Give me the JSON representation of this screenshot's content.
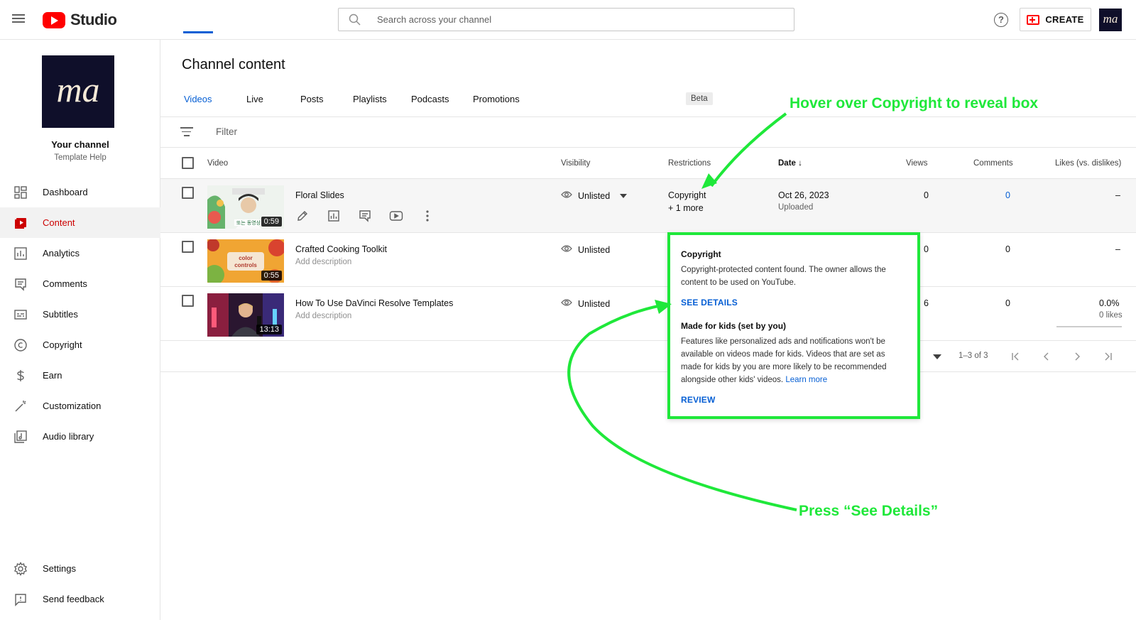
{
  "app": {
    "name": "Studio",
    "search_placeholder": "Search across your channel",
    "create_label": "CREATE",
    "avatar_initials": "ma"
  },
  "channel": {
    "initials": "ma",
    "name": "Your channel",
    "subtitle": "Template Help"
  },
  "sidebar": {
    "items": [
      {
        "label": "Dashboard",
        "icon": "dashboard-icon"
      },
      {
        "label": "Content",
        "icon": "content-icon",
        "active": true
      },
      {
        "label": "Analytics",
        "icon": "analytics-icon"
      },
      {
        "label": "Comments",
        "icon": "comments-icon"
      },
      {
        "label": "Subtitles",
        "icon": "subtitles-icon"
      },
      {
        "label": "Copyright",
        "icon": "copyright-icon"
      },
      {
        "label": "Earn",
        "icon": "dollar-icon"
      },
      {
        "label": "Customization",
        "icon": "magic-wand-icon"
      },
      {
        "label": "Audio library",
        "icon": "audio-library-icon"
      }
    ],
    "bottom": [
      {
        "label": "Settings",
        "icon": "gear-icon"
      },
      {
        "label": "Send feedback",
        "icon": "feedback-icon"
      }
    ]
  },
  "page": {
    "title": "Channel content",
    "tabs": [
      "Videos",
      "Live",
      "Posts",
      "Playlists",
      "Podcasts",
      "Promotions"
    ],
    "active_tab": "Videos",
    "beta_badge": "Beta",
    "filter_label": "Filter"
  },
  "table": {
    "headers": {
      "video": "Video",
      "visibility": "Visibility",
      "restrictions": "Restrictions",
      "date": "Date",
      "views": "Views",
      "comments": "Comments",
      "likes": "Likes (vs. dislikes)"
    },
    "rows": [
      {
        "title": "Floral Slides",
        "description": "",
        "duration": "0:59",
        "visibility": "Unlisted",
        "restriction": "Copyright",
        "restriction_more": "+ 1 more",
        "date": "Oct 26, 2023",
        "date_status": "Uploaded",
        "views": "0",
        "comments": "0",
        "likes": "–",
        "likes_sub": ""
      },
      {
        "title": "Crafted Cooking Toolkit",
        "description": "Add description",
        "duration": "0:55",
        "thumb_text": "color controls",
        "visibility": "Unlisted",
        "views": "0",
        "comments": "0",
        "likes": "–",
        "likes_sub": ""
      },
      {
        "title": "How To Use DaVinci Resolve Templates",
        "description": "Add description",
        "duration": "13:13",
        "visibility": "Unlisted",
        "views": "6",
        "comments": "0",
        "likes": "0.0%",
        "likes_sub": "0 likes"
      }
    ]
  },
  "pagination": {
    "range": "1–3 of 3"
  },
  "popup": {
    "copyright_title": "Copyright",
    "copyright_text": "Copyright-protected content found. The owner allows the content to be used on YouTube.",
    "see_details": "SEE DETAILS",
    "kids_title": "Made for kids (set by you)",
    "kids_text": "Features like personalized ads and notifications won't be available on videos made for kids. Videos that are set as made for kids by you are more likely to be recommended alongside other kids' videos.",
    "learn_more": "Learn more",
    "review": "REVIEW"
  },
  "annotations": {
    "top": "Hover over Copyright to reveal box",
    "bottom": "Press “See Details”",
    "color": "#1fe83a"
  }
}
